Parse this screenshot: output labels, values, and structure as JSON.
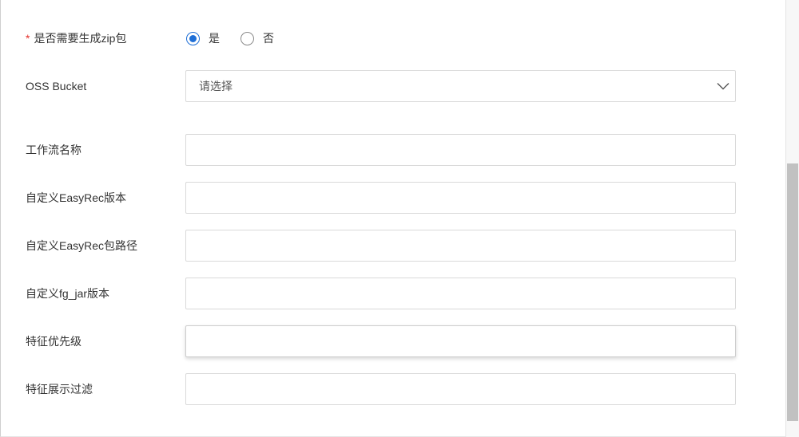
{
  "form": {
    "zip": {
      "required_mark": "*",
      "label": "是否需要生成zip包",
      "options": [
        {
          "label": "是",
          "selected": true
        },
        {
          "label": "否",
          "selected": false
        }
      ]
    },
    "oss_bucket": {
      "label": "OSS Bucket",
      "placeholder": "请选择",
      "icon": "chevron-down-icon"
    },
    "fields": [
      {
        "label": "工作流名称",
        "value": ""
      },
      {
        "label": "自定义EasyRec版本",
        "value": ""
      },
      {
        "label": "自定义EasyRec包路径",
        "value": ""
      },
      {
        "label": "自定义fg_jar版本",
        "value": ""
      },
      {
        "label": "特征优先级",
        "value": ""
      },
      {
        "label": "特征展示过滤",
        "value": ""
      }
    ]
  },
  "colors": {
    "accent": "#1f6fd6",
    "required": "#e5322d",
    "label_text": "#333333",
    "input_border": "#d9d9d9"
  }
}
